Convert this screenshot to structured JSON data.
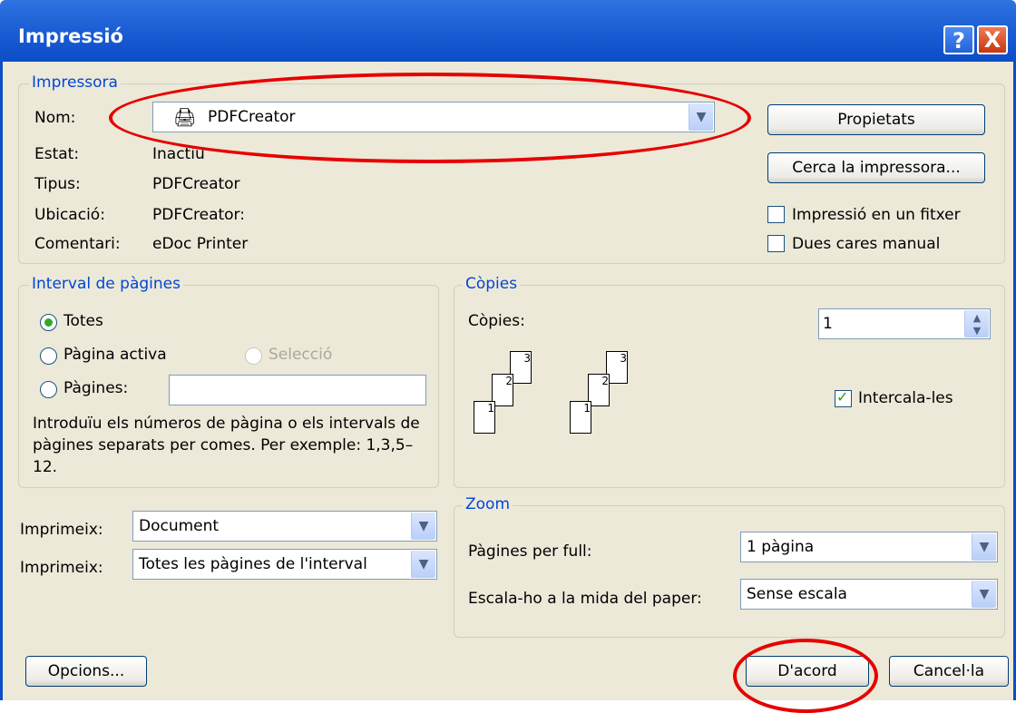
{
  "window": {
    "title": "Impressió",
    "help_glyph": "?",
    "close_glyph": "X"
  },
  "printer": {
    "legend": "Impressora",
    "name_label": "Nom:",
    "name_value": "PDFCreator",
    "status_label": "Estat:",
    "status_value": "Inactiu",
    "type_label": "Tipus:",
    "type_value": "PDFCreator",
    "location_label": "Ubicació:",
    "location_value": "PDFCreator:",
    "comment_label": "Comentari:",
    "comment_value": "eDoc Printer",
    "properties_button": "Propietats",
    "find_button": "Cerca la impressora...",
    "print_to_file": "Impressió en un fitxer",
    "manual_duplex": "Dues cares manual"
  },
  "page_range": {
    "legend": "Interval de pàgines",
    "all": "Totes",
    "current": "Pàgina activa",
    "selection": "Selecció",
    "pages": "Pàgines:",
    "hint": "Introduïu els números de pàgina o els intervals de pàgines separats per comes. Per exemple: 1,3,5–12."
  },
  "copies": {
    "legend": "Còpies",
    "label": "Còpies:",
    "value": "1",
    "collate": "Intercala-les",
    "page_numbers": [
      "3",
      "2",
      "1"
    ]
  },
  "print_what": {
    "label": "Imprimeix:",
    "value": "Document"
  },
  "print": {
    "label": "Imprimeix:",
    "value": "Totes les pàgines de l'interval"
  },
  "zoom": {
    "legend": "Zoom",
    "pages_per_sheet_label": "Pàgines per full:",
    "pages_per_sheet_value": "1 pàgina",
    "scale_label": "Escala-ho a la mida del paper:",
    "scale_value": "Sense escala"
  },
  "buttons": {
    "options": "Opcions...",
    "ok": "D'acord",
    "cancel": "Cancel·la"
  },
  "state": {
    "radio_selected": "all",
    "collate_checked": true,
    "print_to_file_checked": false,
    "manual_duplex_checked": false
  },
  "colors": {
    "titlebar": "#0c4dc8",
    "annotation": "#e60000",
    "legend": "#0046d5"
  }
}
